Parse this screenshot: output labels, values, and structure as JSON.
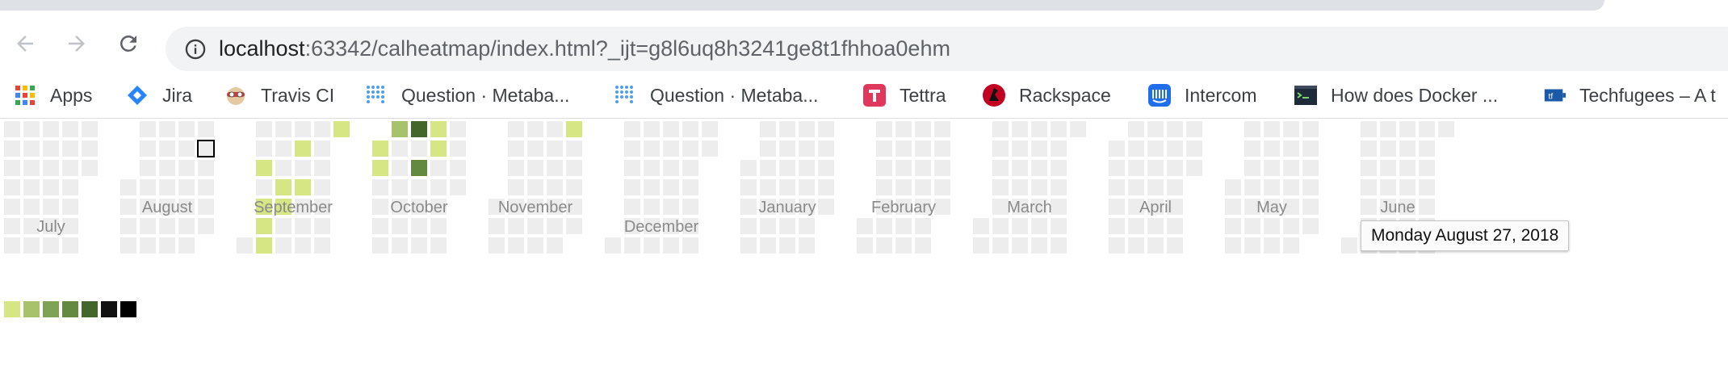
{
  "browser": {
    "url_host": "localhost",
    "url_rest": ":63342/calheatmap/index.html?_ijt=g8l6uq8h3241ge8t1fhhoa0ehm",
    "bookmarks": [
      {
        "label": "Apps",
        "icon": "apps-grid-icon"
      },
      {
        "label": "Jira",
        "icon": "jira-icon"
      },
      {
        "label": "Travis CI",
        "icon": "travis-ci-icon"
      },
      {
        "label": "Question · Metaba...",
        "icon": "metabase-icon"
      },
      {
        "label": "Question · Metaba...",
        "icon": "metabase-icon"
      },
      {
        "label": "Tettra",
        "icon": "tettra-icon"
      },
      {
        "label": "Rackspace",
        "icon": "rackspace-icon"
      },
      {
        "label": "Intercom",
        "icon": "intercom-icon"
      },
      {
        "label": "How does Docker ...",
        "icon": "docker-terminal-icon"
      },
      {
        "label": "Techfugees – A t",
        "icon": "techfugees-icon"
      }
    ]
  },
  "heatmap": {
    "months": [
      {
        "label": "July"
      },
      {
        "label": "August"
      },
      {
        "label": "September"
      },
      {
        "label": "October"
      },
      {
        "label": "November"
      },
      {
        "label": "December"
      },
      {
        "label": "January"
      },
      {
        "label": "February"
      },
      {
        "label": "March"
      },
      {
        "label": "April"
      },
      {
        "label": "May"
      },
      {
        "label": "June"
      }
    ],
    "empty_color": "#ededed",
    "legend_colors": [
      "#d6e685",
      "#a7c26a",
      "#7ea354",
      "#63883f",
      "#44662a",
      "#111111",
      "#000000"
    ],
    "tooltip": "Monday August 27, 2018"
  }
}
